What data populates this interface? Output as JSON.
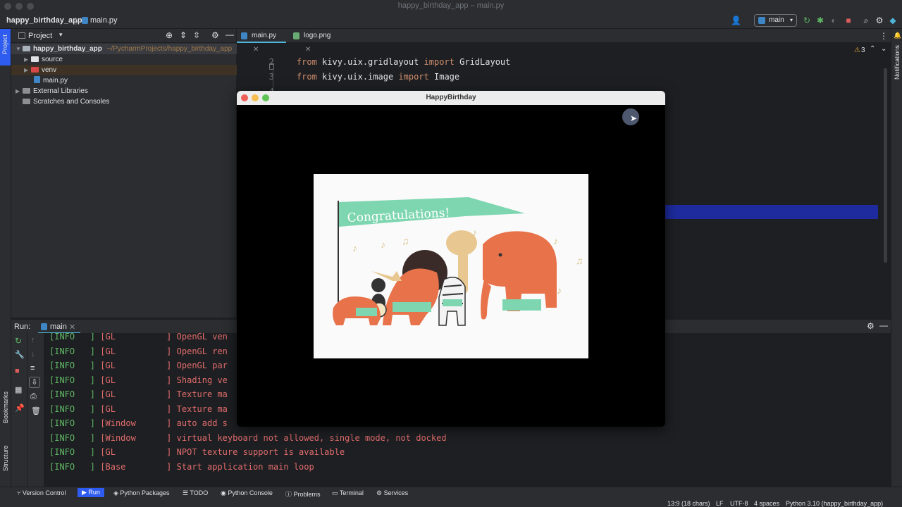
{
  "window": {
    "title": "happy_birthday_app – main.py"
  },
  "navbar": {
    "project": "happy_birthday_app",
    "file": "main.py",
    "branch": "main"
  },
  "left_stripe": {
    "project_label": "Project",
    "bookmarks_label": "Bookmarks",
    "structure_label": "Structure"
  },
  "right_stripe": {
    "notifications_label": "Notifications"
  },
  "project_panel": {
    "title": "Project",
    "tree": [
      {
        "label": "happy_birthday_app",
        "path": "~/PycharmProjects/happy_birthday_app"
      },
      {
        "label": "source"
      },
      {
        "label": "venv"
      },
      {
        "label": "main.py"
      },
      {
        "label": "External Libraries"
      },
      {
        "label": "Scratches and Consoles"
      }
    ]
  },
  "editor": {
    "tabs": [
      {
        "label": "main.py"
      },
      {
        "label": "logo.png"
      }
    ],
    "warnings": "3",
    "lines": [
      {
        "num": "2",
        "kw1": "from",
        "mod": " kivy.uix.gridlayout ",
        "kw2": "import",
        "name": " GridLayout"
      },
      {
        "num": "3",
        "kw1": "from",
        "mod": " kivy.uix.image ",
        "kw2": "import",
        "name": " Image"
      },
      {
        "num": "4",
        "kw1": "",
        "mod": "",
        "kw2": "",
        "name": ""
      }
    ]
  },
  "kivy_window": {
    "title": "HappyBirthday",
    "banner_text": "Congratulations!"
  },
  "run_panel": {
    "label": "Run:",
    "tab": "main",
    "logs": [
      {
        "level": "[INFO   ]",
        "src": "[GL          ]",
        "msg": "OpenGL ven"
      },
      {
        "level": "[INFO   ]",
        "src": "[GL          ]",
        "msg": "OpenGL ren"
      },
      {
        "level": "[INFO   ]",
        "src": "[GL          ]",
        "msg": "OpenGL par"
      },
      {
        "level": "[INFO   ]",
        "src": "[GL          ]",
        "msg": "Shading ve"
      },
      {
        "level": "[INFO   ]",
        "src": "[GL          ]",
        "msg": "Texture ma"
      },
      {
        "level": "[INFO   ]",
        "src": "[GL          ]",
        "msg": "Texture ma"
      },
      {
        "level": "[INFO   ]",
        "src": "[Window      ]",
        "msg": "auto add s"
      },
      {
        "level": "[INFO   ]",
        "src": "[Window      ]",
        "msg": "virtual keyboard not allowed, single mode, not docked"
      },
      {
        "level": "[INFO   ]",
        "src": "[GL          ]",
        "msg": "NPOT texture support is available"
      },
      {
        "level": "[INFO   ]",
        "src": "[Base        ]",
        "msg": "Start application main loop"
      }
    ]
  },
  "statusbar": {
    "items": [
      "Version Control",
      "Run",
      "Python Packages",
      "TODO",
      "Python Console",
      "Problems",
      "Terminal",
      "Services"
    ],
    "position": "13:9 (18 chars)",
    "line_sep": "LF",
    "encoding": "UTF-8",
    "indent": "4 spaces",
    "interpreter": "Python 3.10 (happy_birthday_app)"
  },
  "colors": {
    "accent": "#2f5cf0",
    "keyword": "#cf8e6d",
    "log_text": "#e06c6c",
    "info": "#5fb865",
    "banner": "#7ed6b0",
    "elephant": "#e8734a"
  }
}
